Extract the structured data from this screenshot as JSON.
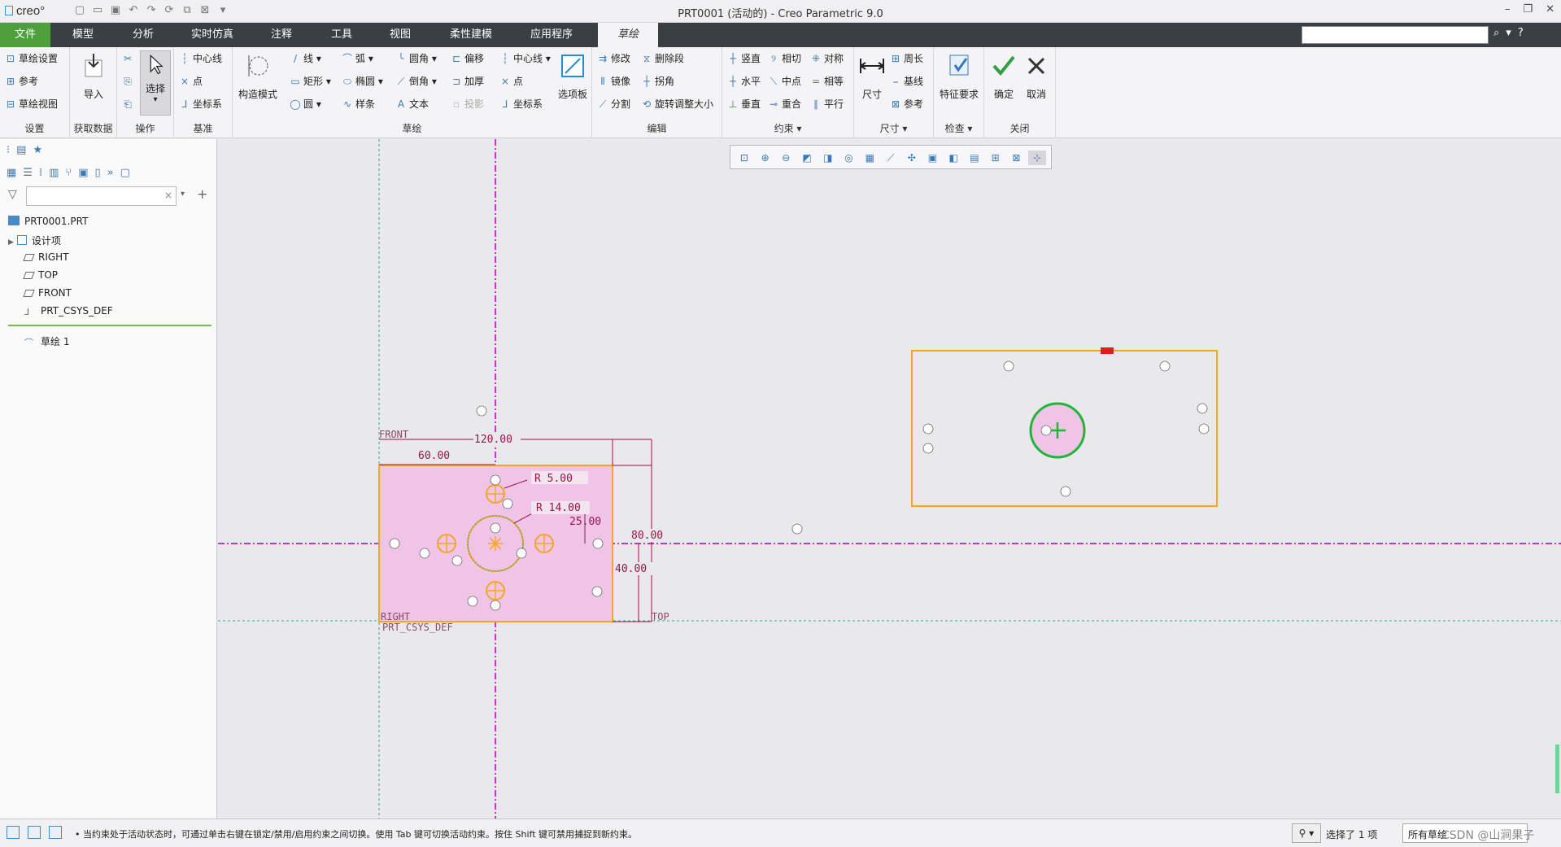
{
  "titlebar": {
    "logo": "creo°",
    "title": "PRT0001 (活动的) - Creo Parametric 9.0",
    "window_controls": [
      "–",
      "❐",
      "✕"
    ]
  },
  "menu": {
    "tabs": [
      "文件",
      "模型",
      "分析",
      "实时仿真",
      "注释",
      "工具",
      "视图",
      "柔性建模",
      "应用程序",
      "草绘"
    ],
    "active": "草绘"
  },
  "ribbon": {
    "setup": {
      "items": [
        "草绘设置",
        "参考",
        "草绘视图"
      ],
      "label": "设置"
    },
    "getdata": {
      "import": "导入",
      "label": "获取数据"
    },
    "operations": {
      "select": "选择",
      "label": "操作"
    },
    "datum": {
      "items": [
        "中心线",
        "点",
        "坐标系"
      ],
      "label": "基准"
    },
    "sketch": {
      "construction": "构造模式",
      "col1": [
        "线",
        "矩形",
        "圆"
      ],
      "col2": [
        "弧",
        "椭圆",
        "样条"
      ],
      "col3": [
        "圆角",
        "倒角",
        "文本"
      ],
      "col4": [
        "偏移",
        "加厚",
        "投影"
      ],
      "col5": [
        "中心线",
        "点",
        "坐标系"
      ],
      "palette": "选项板",
      "label": "草绘"
    },
    "edit": {
      "col1": [
        "修改",
        "镜像",
        "分割"
      ],
      "col2": [
        "删除段",
        "拐角",
        "旋转调整大小"
      ],
      "label": "编辑"
    },
    "constrain": {
      "col1": [
        "竖直",
        "水平",
        "垂直"
      ],
      "col2": [
        "相切",
        "中点",
        "重合"
      ],
      "col3": [
        "对称",
        "相等",
        "平行"
      ],
      "label": "约束"
    },
    "dimension": {
      "big": "尺寸",
      "items": [
        "周长",
        "基线",
        "参考"
      ],
      "label": "尺寸"
    },
    "inspect": {
      "big": "特征要求",
      "label": "检查"
    },
    "close": {
      "ok": "确定",
      "cancel": "取消",
      "label": "关闭"
    }
  },
  "tree": {
    "items": [
      "PRT0001.PRT",
      "设计项",
      "RIGHT",
      "TOP",
      "FRONT",
      "PRT_CSYS_DEF"
    ],
    "sketch": "草绘 1"
  },
  "canvas": {
    "labels": {
      "front": "FRONT",
      "top": "TOP",
      "right": "RIGHT",
      "csys": "PRT_CSYS_DEF"
    },
    "dims": {
      "d120": "120.00",
      "d60": "60.00",
      "r5": "R 5.00",
      "r14": "R 14.00",
      "d25": "25.00",
      "d80": "80.00",
      "d40": "40.00"
    },
    "colors": {
      "pink_fill": "#efc4e6",
      "outline": "#f5a623",
      "dim": "#9a1446",
      "magenta": "#b000b0",
      "cyan": "#2aa6a0",
      "green": "#22b33a"
    }
  },
  "status": {
    "message": "• 当约束处于活动状态时，可通过单击右键在锁定/禁用/启用约束之间切换。使用 Tab 键可切换活动约束。按住 Shift 键可禁用捕捉到新约束。",
    "selected": "选择了 1 项",
    "filter": "所有草绘",
    "watermark": "CSDN @山涧果子"
  }
}
